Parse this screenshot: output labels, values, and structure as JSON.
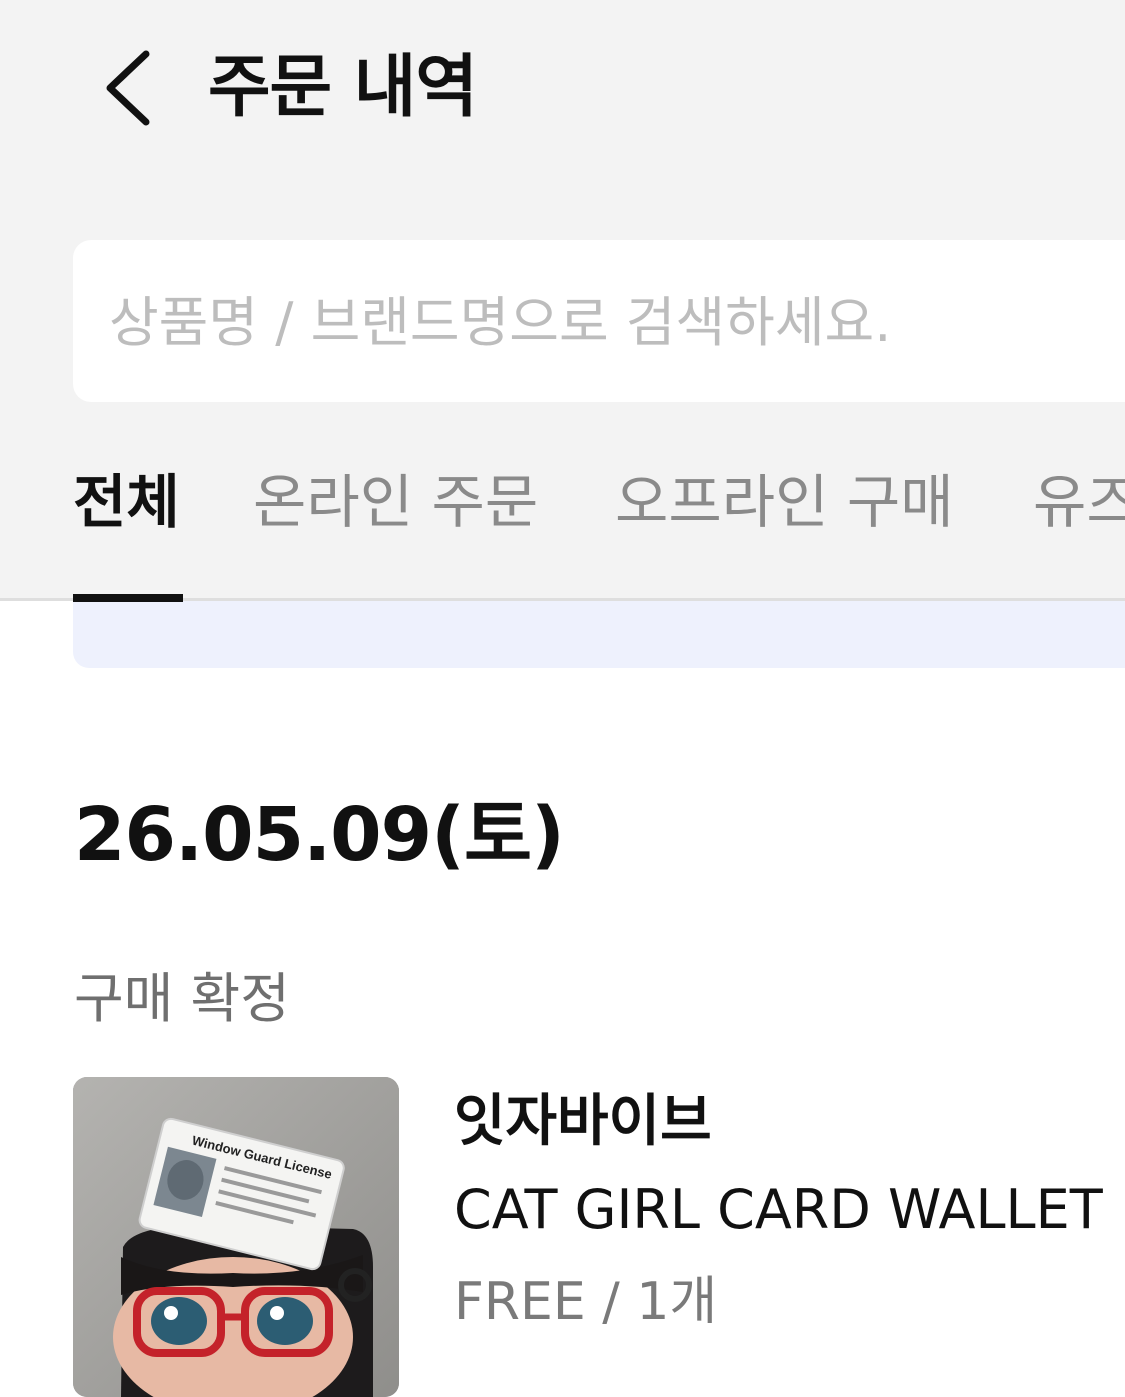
{
  "header": {
    "title": "주문 내역",
    "back_icon": "chevron-left-icon"
  },
  "search": {
    "placeholder": "상품명 / 브랜드명으로 검색하세요.",
    "value": ""
  },
  "tabs": [
    {
      "label": "전체",
      "active": true
    },
    {
      "label": "온라인 주문",
      "active": false
    },
    {
      "label": "오프라인 구매",
      "active": false
    },
    {
      "label": "유즈",
      "active": false
    }
  ],
  "colors": {
    "header_bg": "#f3f3f3",
    "banner_bg": "#eef1fd",
    "text_primary": "#111111",
    "text_secondary": "#8a8a8a"
  },
  "orders": [
    {
      "date": "26.05.09(토)",
      "status": "구매 확정",
      "items": [
        {
          "brand": "잇자바이브",
          "name": "CAT GIRL CARD WALLET",
          "option": "FREE / 1개",
          "thumbnail_card_text": "Window Guard License"
        }
      ]
    }
  ]
}
